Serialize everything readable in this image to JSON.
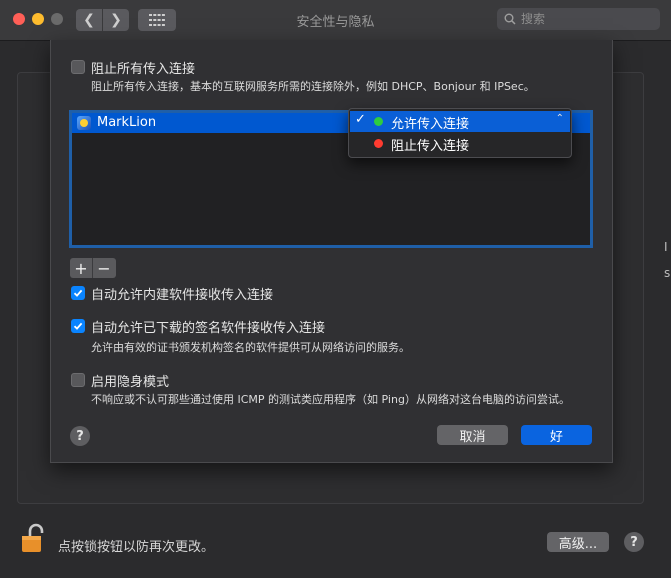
{
  "window": {
    "title": "安全性与隐私",
    "search_placeholder": "搜索"
  },
  "background": {
    "lock_text": "点按锁按钮以防再次更改。",
    "advanced_button": "高级...",
    "help": "?"
  },
  "sheet": {
    "block_all": {
      "label": "阻止所有传入连接",
      "description": "阻止所有传入连接，基本的互联网服务所需的连接除外，例如 DHCP、Bonjour 和 IPSec。",
      "checked": false
    },
    "apps": [
      {
        "name": "MarkLion",
        "status": "允许传入连接"
      }
    ],
    "dropdown": {
      "options": [
        {
          "label": "允许传入连接",
          "color": "#2ecc40",
          "selected": true,
          "checkmark": "✓"
        },
        {
          "label": "阻止传入连接",
          "color": "#ff3b30",
          "selected": false,
          "checkmark": ""
        }
      ]
    },
    "add_label": "+",
    "remove_label": "−",
    "auto_builtin": {
      "label": "自动允许内建软件接收传入连接",
      "checked": true
    },
    "auto_signed": {
      "label": "自动允许已下载的签名软件接收传入连接",
      "description": "允许由有效的证书颁发机构签名的软件提供可从网络访问的服务。",
      "checked": true
    },
    "stealth": {
      "label": "启用隐身模式",
      "description": "不响应或不认可那些通过使用 ICMP 的测试类应用程序（如 Ping）从网络对这台电脑的访问尝试。",
      "checked": false
    },
    "help": "?",
    "cancel": "取消",
    "ok": "好"
  },
  "edge_text": [
    "I",
    "s"
  ],
  "colors": {
    "accent": "#0a84ff",
    "selection": "#0058d0"
  }
}
